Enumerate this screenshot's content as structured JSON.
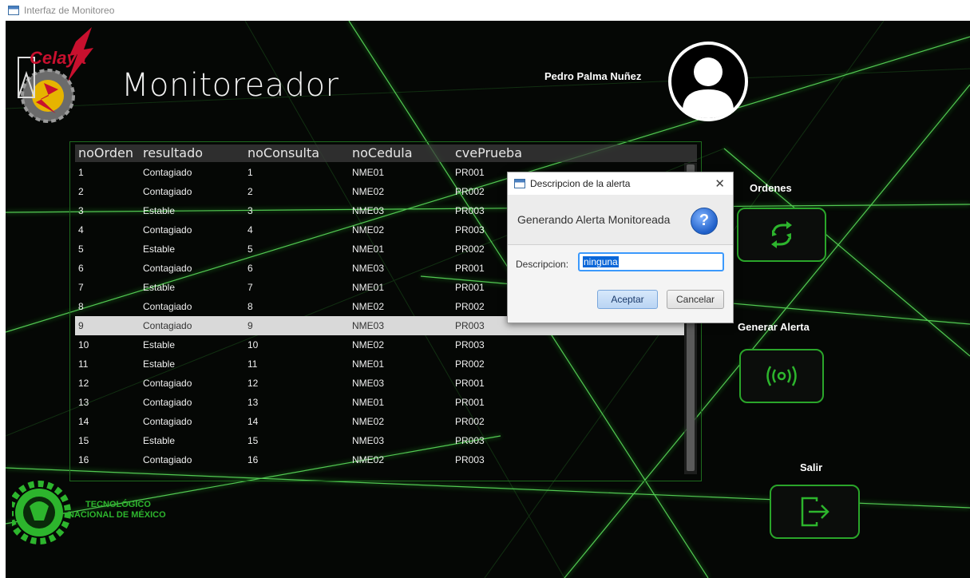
{
  "window": {
    "title": "Interfaz de Monitoreo",
    "icon": "window-icon"
  },
  "header": {
    "logo_text": "Celaya",
    "app_title": "Monitoreador",
    "user_name": "Pedro Palma Nuñez",
    "avatar_icon": "user-avatar-icon"
  },
  "table": {
    "columns": [
      "noOrden",
      "resultado",
      "noConsulta",
      "noCedula",
      "cvePrueba"
    ],
    "selected_row": 8,
    "rows": [
      [
        "1",
        "Contagiado",
        "1",
        "NME01",
        "PR001"
      ],
      [
        "2",
        "Contagiado",
        "2",
        "NME02",
        "PR002"
      ],
      [
        "3",
        "Estable",
        "3",
        "NME03",
        "PR003"
      ],
      [
        "4",
        "Contagiado",
        "4",
        "NME02",
        "PR003"
      ],
      [
        "5",
        "Estable",
        "5",
        "NME01",
        "PR002"
      ],
      [
        "6",
        "Contagiado",
        "6",
        "NME03",
        "PR001"
      ],
      [
        "7",
        "Estable",
        "7",
        "NME01",
        "PR001"
      ],
      [
        "8",
        "Contagiado",
        "8",
        "NME02",
        "PR002"
      ],
      [
        "9",
        "Contagiado",
        "9",
        "NME03",
        "PR003"
      ],
      [
        "10",
        "Estable",
        "10",
        "NME02",
        "PR003"
      ],
      [
        "11",
        "Estable",
        "11",
        "NME01",
        "PR002"
      ],
      [
        "12",
        "Contagiado",
        "12",
        "NME03",
        "PR001"
      ],
      [
        "13",
        "Contagiado",
        "13",
        "NME01",
        "PR001"
      ],
      [
        "14",
        "Contagiado",
        "14",
        "NME02",
        "PR002"
      ],
      [
        "15",
        "Estable",
        "15",
        "NME03",
        "PR003"
      ],
      [
        "16",
        "Contagiado",
        "16",
        "NME02",
        "PR003"
      ]
    ]
  },
  "sidebar": {
    "ordenes_label": "Ordenes",
    "ordenes_icon": "refresh-icon",
    "alerta_label": "Generar Alerta",
    "alerta_icon": "broadcast-icon",
    "salir_label": "Salir",
    "salir_icon": "exit-icon"
  },
  "footer": {
    "tec_line1": "TECNOLÓGICO",
    "tec_line2": "NACIONAL DE MÉXICO"
  },
  "dialog": {
    "title": "Descripcion de la alerta",
    "close": "✕",
    "header_text": "Generando Alerta Monitoreada",
    "question_icon": "?",
    "field_label": "Descripcion:",
    "field_value": "ninguna",
    "ok_label": "Aceptar",
    "cancel_label": "Cancelar"
  },
  "colors": {
    "accent_green": "#2aa52a",
    "background": "#050705",
    "selected_row": "#d9d9d9",
    "dialog_ok": "#b9d4f3"
  }
}
